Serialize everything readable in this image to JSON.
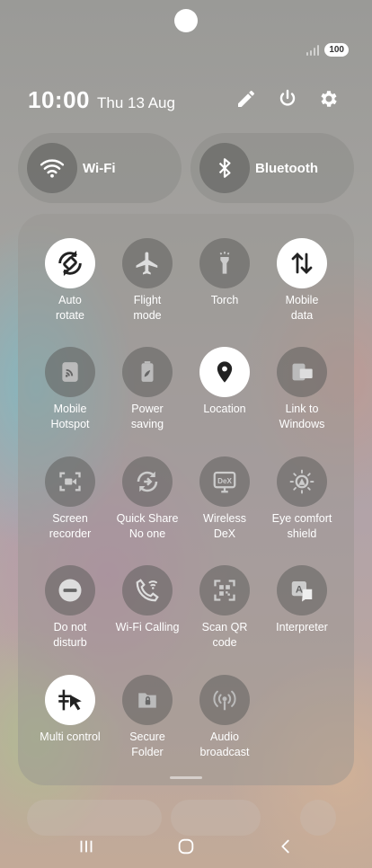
{
  "status": {
    "battery": "100"
  },
  "header": {
    "time": "10:00",
    "date": "Thu 13 Aug",
    "icons": [
      "edit-icon",
      "power-icon",
      "settings-icon"
    ]
  },
  "wide_tiles": [
    {
      "label": "Wi-Fi",
      "icon": "wifi-icon",
      "active": false
    },
    {
      "label": "Bluetooth",
      "icon": "bluetooth-icon",
      "active": false
    }
  ],
  "tiles": [
    {
      "label": "Auto\nrotate",
      "icon": "auto-rotate-icon",
      "active": true
    },
    {
      "label": "Flight\nmode",
      "icon": "airplane-icon",
      "active": false
    },
    {
      "label": "Torch",
      "icon": "torch-icon",
      "active": false
    },
    {
      "label": "Mobile\ndata",
      "icon": "mobile-data-icon",
      "active": true
    },
    {
      "label": "Mobile\nHotspot",
      "icon": "hotspot-icon",
      "active": false
    },
    {
      "label": "Power\nsaving",
      "icon": "battery-leaf-icon",
      "active": false
    },
    {
      "label": "Location",
      "icon": "location-pin-icon",
      "active": true
    },
    {
      "label": "Link to\nWindows",
      "icon": "link-to-windows-icon",
      "active": false
    },
    {
      "label": "Screen\nrecorder",
      "icon": "screen-recorder-icon",
      "active": false
    },
    {
      "label": "Quick Share\nNo one",
      "icon": "quick-share-icon",
      "active": false
    },
    {
      "label": "Wireless\nDeX",
      "icon": "dex-icon",
      "active": false
    },
    {
      "label": "Eye comfort\nshield",
      "icon": "eye-comfort-icon",
      "active": false
    },
    {
      "label": "Do not\ndisturb",
      "icon": "do-not-disturb-icon",
      "active": false
    },
    {
      "label": "Wi-Fi Calling",
      "icon": "wifi-calling-icon",
      "active": false
    },
    {
      "label": "Scan QR\ncode",
      "icon": "qr-scan-icon",
      "active": false
    },
    {
      "label": "Interpreter",
      "icon": "interpreter-icon",
      "active": false
    },
    {
      "label": "Multi control",
      "icon": "multi-control-icon",
      "active": true
    },
    {
      "label": "Secure\nFolder",
      "icon": "secure-folder-icon",
      "active": false
    },
    {
      "label": "Audio\nbroadcast",
      "icon": "audio-broadcast-icon",
      "active": false
    }
  ],
  "nav": [
    "recents-icon",
    "home-icon",
    "back-icon"
  ]
}
